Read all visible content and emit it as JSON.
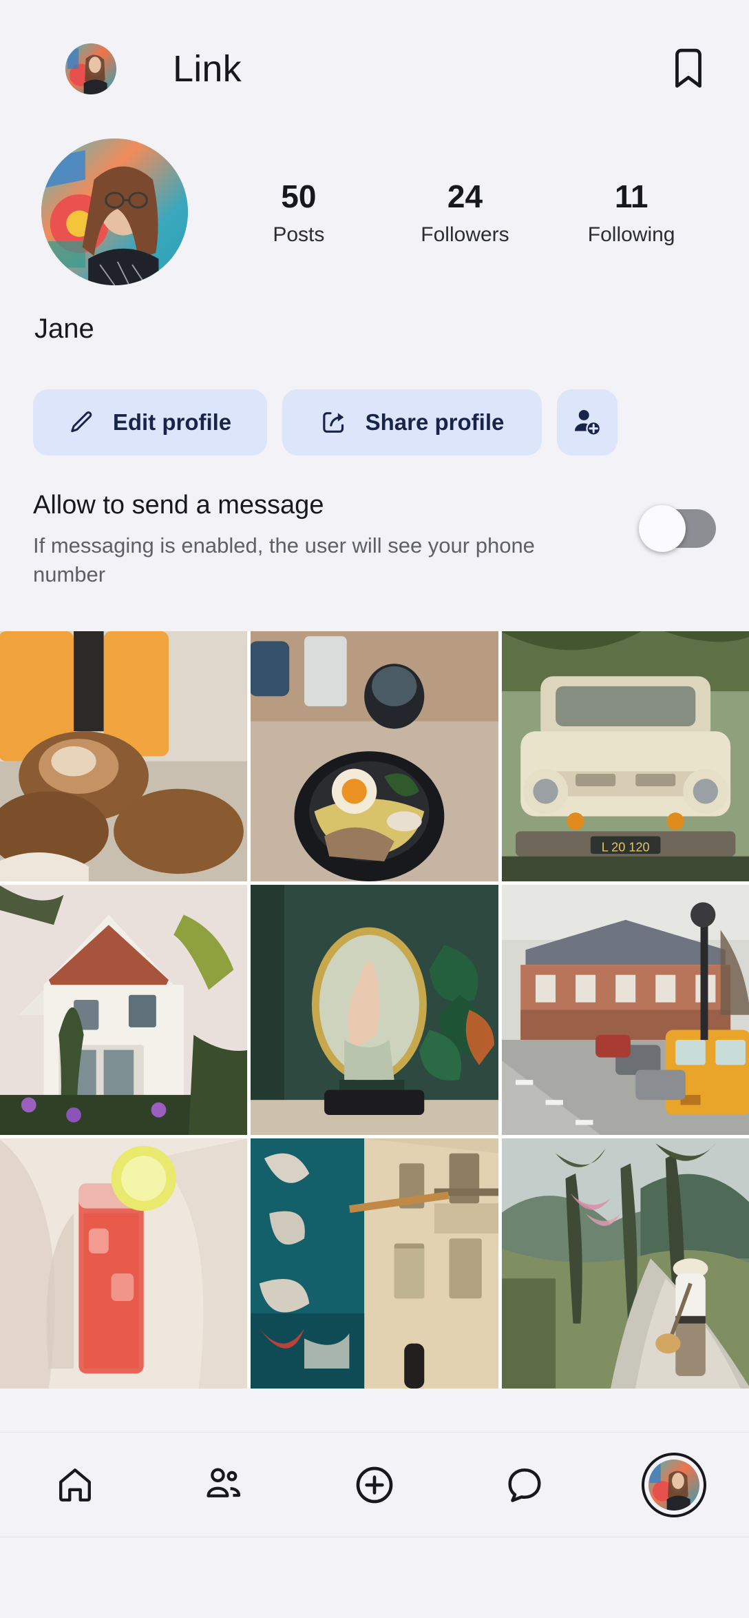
{
  "app": {
    "background_color": "#f2f2f7",
    "accent_button_bg": "#dce5fa",
    "accent_button_fg": "#18244a",
    "text_primary": "#16181d",
    "text_secondary": "#5e6066"
  },
  "header": {
    "title": "Link",
    "avatar_name": "header-avatar",
    "bookmark_icon": "bookmark-icon"
  },
  "profile": {
    "avatar_name": "profile-avatar",
    "display_name": "Jane",
    "stats": [
      {
        "value": "50",
        "label": "Posts"
      },
      {
        "value": "24",
        "label": "Followers"
      },
      {
        "value": "11",
        "label": "Following"
      }
    ]
  },
  "actions": {
    "edit": {
      "label": "Edit profile",
      "icon": "pencil-icon"
    },
    "share": {
      "label": "Share profile",
      "icon": "share-icon"
    },
    "add_person": {
      "icon": "add-person-icon"
    }
  },
  "setting": {
    "title": "Allow to send a message",
    "description": "If messaging is enabled, the user will see your phone number",
    "toggle_state": "off"
  },
  "grid": {
    "tiles": [
      {
        "id": "tile-1",
        "alt": "Croissants with two glasses of orange juice"
      },
      {
        "id": "tile-2",
        "alt": "Ramen bowl with soft egg and pork on a table"
      },
      {
        "id": "tile-3",
        "alt": "Vintage cream pickup truck under trees"
      },
      {
        "id": "tile-4",
        "alt": "White Victorian house with palm and garden"
      },
      {
        "id": "tile-5",
        "alt": "Hand reflected in an oval mirror on green wall"
      },
      {
        "id": "tile-6",
        "alt": "Paris street with yellow van and parked cars"
      },
      {
        "id": "tile-7",
        "alt": "Pink iced drink with lemon slice in sunlight"
      },
      {
        "id": "tile-8",
        "alt": "Graffiti covered building facade"
      },
      {
        "id": "tile-9",
        "alt": "Woman walking a countryside path with basket"
      }
    ]
  },
  "navbar": {
    "items": [
      {
        "id": "nav-home",
        "icon": "home-icon",
        "active": false
      },
      {
        "id": "nav-friends",
        "icon": "people-icon",
        "active": false
      },
      {
        "id": "nav-create",
        "icon": "plus-circle-icon",
        "active": false
      },
      {
        "id": "nav-messages",
        "icon": "chat-bubble-icon",
        "active": false
      },
      {
        "id": "nav-profile",
        "icon": "profile-avatar-icon",
        "active": true
      }
    ]
  }
}
